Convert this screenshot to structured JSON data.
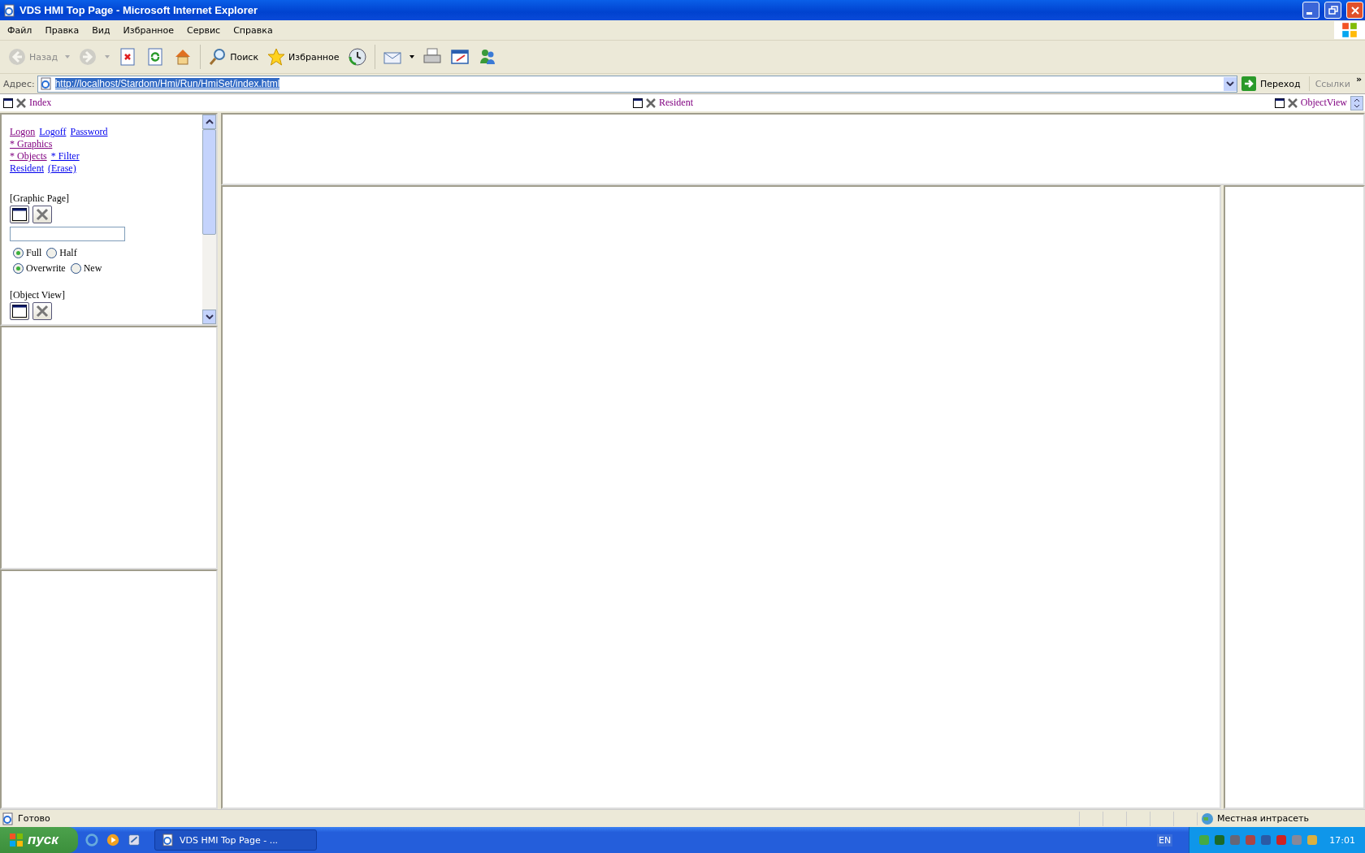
{
  "window": {
    "title": "VDS HMI Top Page - Microsoft Internet Explorer"
  },
  "menu": [
    "Файл",
    "Правка",
    "Вид",
    "Избранное",
    "Сервис",
    "Справка"
  ],
  "toolbar": [
    {
      "kind": "back",
      "label": "Назад",
      "disabled": true,
      "dropdown": true
    },
    {
      "kind": "forward",
      "disabled": true,
      "dropdown": true
    },
    {
      "kind": "stop",
      "disabled": false,
      "dropdown": false
    },
    {
      "kind": "refresh",
      "disabled": false,
      "dropdown": false
    },
    {
      "kind": "home",
      "disabled": false,
      "dropdown": false
    },
    {
      "kind": "search",
      "label": "Поиск",
      "disabled": false,
      "dropdown": false
    },
    {
      "kind": "favorites",
      "label": "Избранное",
      "disabled": false,
      "dropdown": false
    },
    {
      "kind": "history",
      "disabled": false,
      "dropdown": false
    },
    {
      "kind": "mail",
      "disabled": false,
      "dropdown": true
    },
    {
      "kind": "print",
      "disabled": false,
      "dropdown": false
    },
    {
      "kind": "edit",
      "disabled": false,
      "dropdown": false
    },
    {
      "kind": "messenger",
      "disabled": false,
      "dropdown": false
    }
  ],
  "address": {
    "label": "Адрес:",
    "value": "http://localhost/Stardom/Hmi/Run/HmiSet/index.html",
    "go": "Переход",
    "links": "Ссылки",
    "more": "»"
  },
  "frame_headers": [
    {
      "label": "Index"
    },
    {
      "label": "Resident"
    },
    {
      "label": "ObjectView"
    }
  ],
  "index_panel": {
    "link_rows": [
      [
        {
          "text": "Logon",
          "visited": true
        },
        {
          "text": "Logoff",
          "visited": false
        },
        {
          "text": "Password",
          "visited": false
        }
      ],
      [
        {
          "text": "* Graphics",
          "visited": true
        }
      ],
      [
        {
          "text": "* Objects",
          "visited": true
        },
        {
          "text": "* Filter",
          "visited": false
        }
      ],
      [
        {
          "text": "Resident",
          "visited": false
        },
        {
          "text": "(Erase)",
          "visited": false
        }
      ]
    ],
    "graphic_page": {
      "heading": "[Graphic Page]",
      "radio_rows": [
        [
          {
            "label": "Full",
            "selected": true
          },
          {
            "label": "Half",
            "selected": false
          }
        ],
        [
          {
            "label": "Overwrite",
            "selected": true
          },
          {
            "label": "New",
            "selected": false
          }
        ]
      ]
    },
    "object_view": {
      "heading": "[Object View]"
    }
  },
  "status_bar": {
    "text": "Готово",
    "zone": "Местная интрасеть"
  },
  "taskbar": {
    "start": "пуск",
    "task": "VDS HMI Top Page - ...",
    "language": "EN",
    "time": "17:01"
  }
}
